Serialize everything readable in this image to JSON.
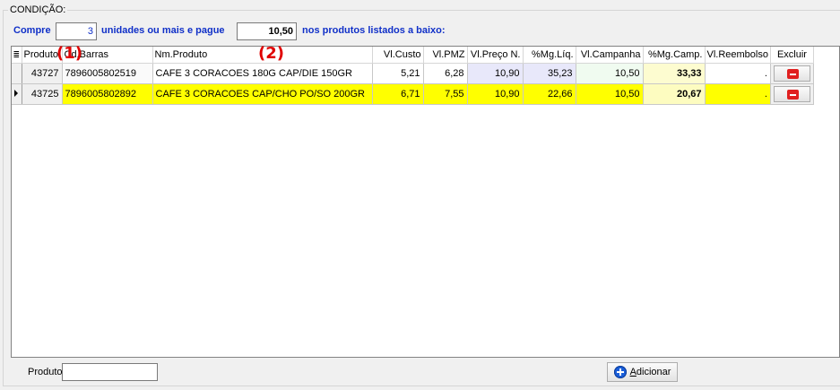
{
  "condition": {
    "title": "CONDIÇÃO:",
    "label_buy": "Compre",
    "qty": "3",
    "label_units": "unidades ou mais e pague",
    "price": "10,50",
    "label_products": "nos produtos listados a baixo:"
  },
  "grid": {
    "columns": {
      "menu": "≣",
      "produto": "Produto",
      "barras": "Cd.Barras",
      "nome": "Nm.Produto",
      "custo": "Vl.Custo",
      "pmz": "Vl.PMZ",
      "preco": "Vl.Preço N.",
      "mgliq": "%Mg.Líq.",
      "campanha": "Vl.Campanha",
      "mgcamp": "%Mg.Camp.",
      "reembolso": "Vl.Reembolso",
      "excluir": "Excluir"
    },
    "rows": [
      {
        "produto": "43727",
        "barras": "7896005802519",
        "nome": "CAFE 3 CORACOES 180G CAP/DIE  150GR",
        "custo": "5,21",
        "pmz": "6,28",
        "preco": "10,90",
        "mgliq": "35,23",
        "campanha": "10,50",
        "mgcamp": "33,33",
        "reembolso": "."
      },
      {
        "produto": "43725",
        "barras": "7896005802892",
        "nome": "CAFE 3 CORACOES CAP/CHO PO/SO 200GR",
        "custo": "6,71",
        "pmz": "7,55",
        "preco": "10,90",
        "mgliq": "22,66",
        "campanha": "10,50",
        "mgcamp": "20,67",
        "reembolso": "."
      }
    ]
  },
  "annotations": {
    "marker1": "(1)",
    "marker2": "(2)"
  },
  "footer": {
    "produto_label": "Produto",
    "add_first_letter": "A",
    "add_rest": "dicionar"
  },
  "colors": {
    "label_blue": "#1030c8",
    "highlight_row": "#ffff00",
    "marker_red": "#e00000",
    "delete_red": "#e02020",
    "add_icon_blue": "#1a5ed8"
  },
  "icons": {
    "delete": "minus-icon",
    "add": "plus-circle-icon",
    "row_indicator": "current-row-arrow-icon"
  }
}
